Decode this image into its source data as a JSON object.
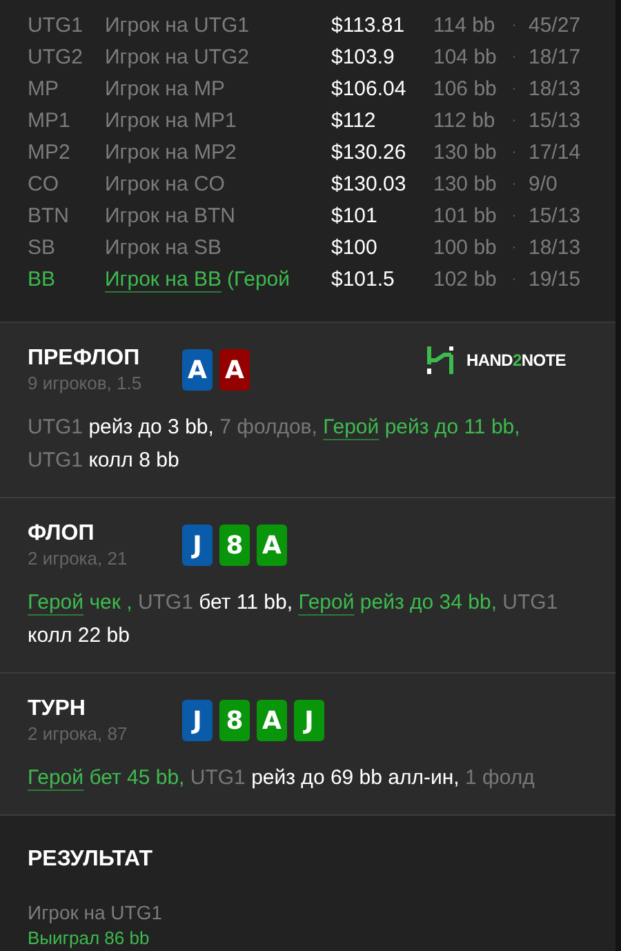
{
  "players": [
    {
      "position": "UTG1",
      "name": "Игрок на UTG1",
      "stack": "$113.81",
      "bb": "114 bb",
      "separator": "·",
      "stats": "45/27",
      "hero": false
    },
    {
      "position": "UTG2",
      "name": "Игрок на UTG2",
      "stack": "$103.9",
      "bb": "104 bb",
      "separator": "·",
      "stats": "18/17",
      "hero": false
    },
    {
      "position": "MP",
      "name": "Игрок на MP",
      "stack": "$106.04",
      "bb": "106 bb",
      "separator": "·",
      "stats": "18/13",
      "hero": false
    },
    {
      "position": "MP1",
      "name": "Игрок на MP1",
      "stack": "$112",
      "bb": "112 bb",
      "separator": "·",
      "stats": "15/13",
      "hero": false
    },
    {
      "position": "MP2",
      "name": "Игрок на MP2",
      "stack": "$130.26",
      "bb": "130 bb",
      "separator": "·",
      "stats": "17/14",
      "hero": false
    },
    {
      "position": "CO",
      "name": "Игрок на CO",
      "stack": "$130.03",
      "bb": "130 bb",
      "separator": "·",
      "stats": "9/0",
      "hero": false
    },
    {
      "position": "BTN",
      "name": "Игрок на BTN",
      "stack": "$101",
      "bb": "101 bb",
      "separator": "·",
      "stats": "15/13",
      "hero": false
    },
    {
      "position": "SB",
      "name": "Игрок на SB",
      "stack": "$100",
      "bb": "100 bb",
      "separator": "·",
      "stats": "18/13",
      "hero": false
    },
    {
      "position": "BB",
      "name": "Игрок на BB",
      "note": "(Герой",
      "stack": "$101.5",
      "bb": "102 bb",
      "separator": "·",
      "stats": "19/15",
      "hero": true
    }
  ],
  "logo": {
    "prefix": "HAND",
    "accent": "2",
    "suffix": "NOTE"
  },
  "streets": [
    {
      "title": "ПРЕФЛОП",
      "subtitle": "9 игроков, 1.5",
      "logo": true,
      "cards": [
        {
          "rank": "A",
          "color": "#0b5bab"
        },
        {
          "rank": "A",
          "color": "#950000"
        }
      ],
      "actions": [
        {
          "kind": "player",
          "text": "UTG1"
        },
        {
          "kind": "action",
          "text": "рейз до 3 bb,"
        },
        {
          "kind": "player",
          "text": "7 фолдов,"
        },
        {
          "kind": "hero",
          "text": "Герой"
        },
        {
          "kind": "hero_action",
          "text": "рейз до 11 bb,"
        },
        {
          "kind": "player",
          "text": "UTG1"
        },
        {
          "kind": "action",
          "text": "колл 8 bb"
        }
      ]
    },
    {
      "title": "ФЛОП",
      "subtitle": "2 игрока, 21",
      "logo": false,
      "cards": [
        {
          "rank": "J",
          "color": "#0b5bab"
        },
        {
          "rank": "8",
          "color": "#0a960a"
        },
        {
          "rank": "A",
          "color": "#0a960a"
        }
      ],
      "actions": [
        {
          "kind": "hero",
          "text": "Герой"
        },
        {
          "kind": "hero_action",
          "text": "чек ,"
        },
        {
          "kind": "player",
          "text": "UTG1"
        },
        {
          "kind": "action",
          "text": "бет 11 bb,"
        },
        {
          "kind": "hero",
          "text": "Герой"
        },
        {
          "kind": "hero_action",
          "text": "рейз до 34 bb,"
        },
        {
          "kind": "player",
          "text": "UTG1"
        },
        {
          "kind": "action",
          "text": "колл 22 bb"
        }
      ]
    },
    {
      "title": "ТУРН",
      "subtitle": "2 игрока, 87",
      "logo": false,
      "cards": [
        {
          "rank": "J",
          "color": "#0b5bab"
        },
        {
          "rank": "8",
          "color": "#0a960a"
        },
        {
          "rank": "A",
          "color": "#0a960a"
        },
        {
          "rank": "J",
          "color": "#0a960a"
        }
      ],
      "actions": [
        {
          "kind": "hero",
          "text": "Герой"
        },
        {
          "kind": "hero_action",
          "text": "бет 45 bb,"
        },
        {
          "kind": "player",
          "text": "UTG1"
        },
        {
          "kind": "action",
          "text": "рейз до 69 bb алл-ин,"
        },
        {
          "kind": "player",
          "text": "1 фолд"
        }
      ]
    }
  ],
  "result": {
    "title": "РЕЗУЛЬТАТ",
    "winner": "Игрок на UTG1",
    "outcome": "Выиграл 86 bb"
  }
}
